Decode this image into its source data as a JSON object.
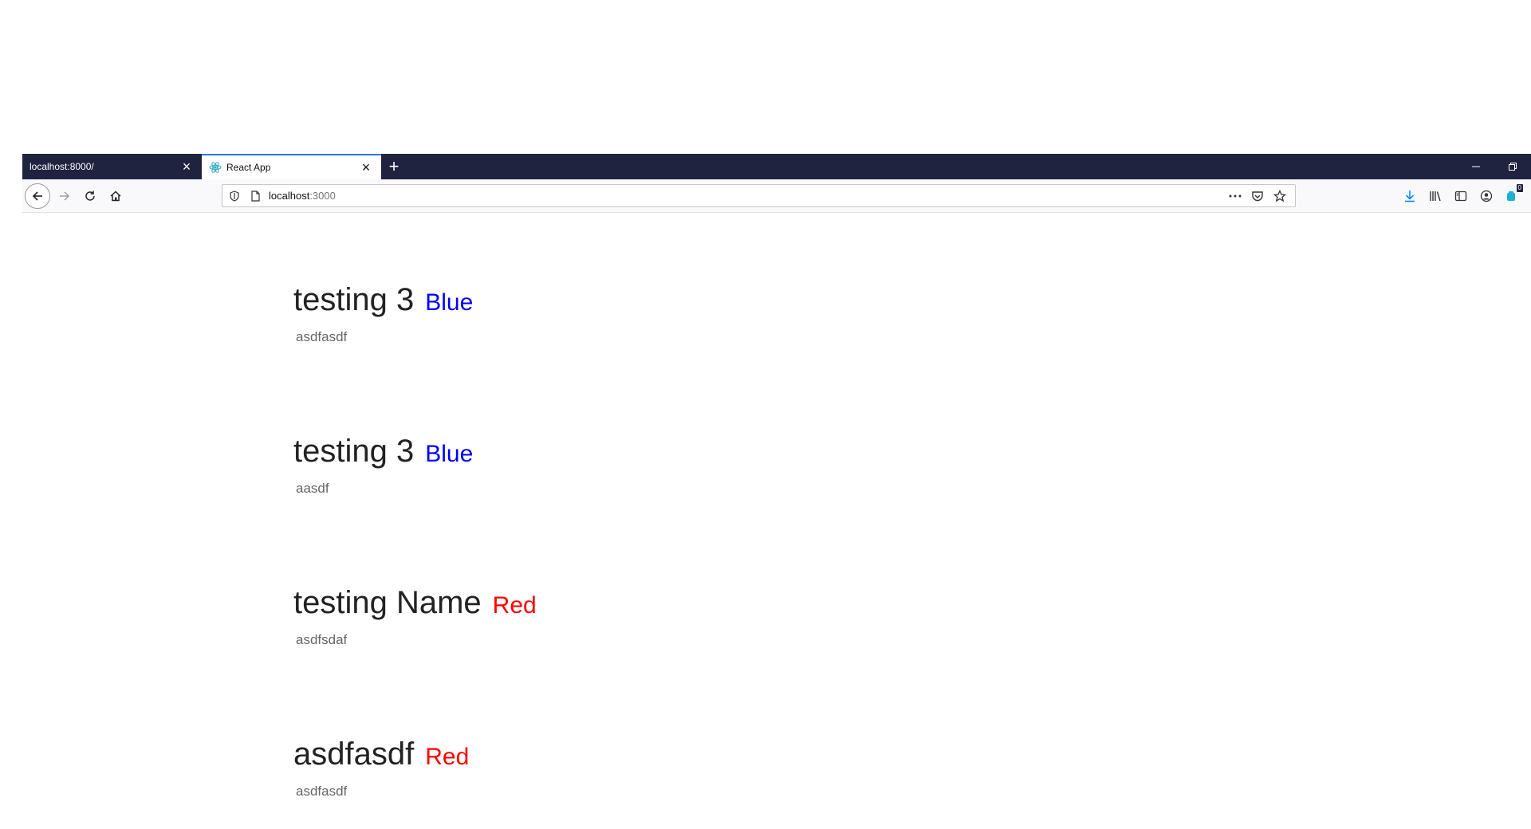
{
  "browser": {
    "tabs": [
      {
        "label": "localhost:8000/",
        "active": false
      },
      {
        "label": "React App",
        "active": true
      }
    ],
    "new_tab_label": "+",
    "url": {
      "host": "localhost",
      "port": ":3000"
    },
    "toolbar_badge": "0",
    "accent_color": "#2a78d8",
    "tabbar_color": "#1f2340"
  },
  "cards": [
    {
      "name": "testing 3",
      "color_label": "Blue",
      "color_hex": "#0000ff",
      "description": "asdfasdf"
    },
    {
      "name": "testing 3",
      "color_label": "Blue",
      "color_hex": "#0000ff",
      "description": "aasdf"
    },
    {
      "name": "testing Name",
      "color_label": "Red",
      "color_hex": "#ff0000",
      "description": "asdfsdaf"
    },
    {
      "name": "asdfasdf",
      "color_label": "Red",
      "color_hex": "#ff0000",
      "description": "asdfasdf"
    }
  ]
}
